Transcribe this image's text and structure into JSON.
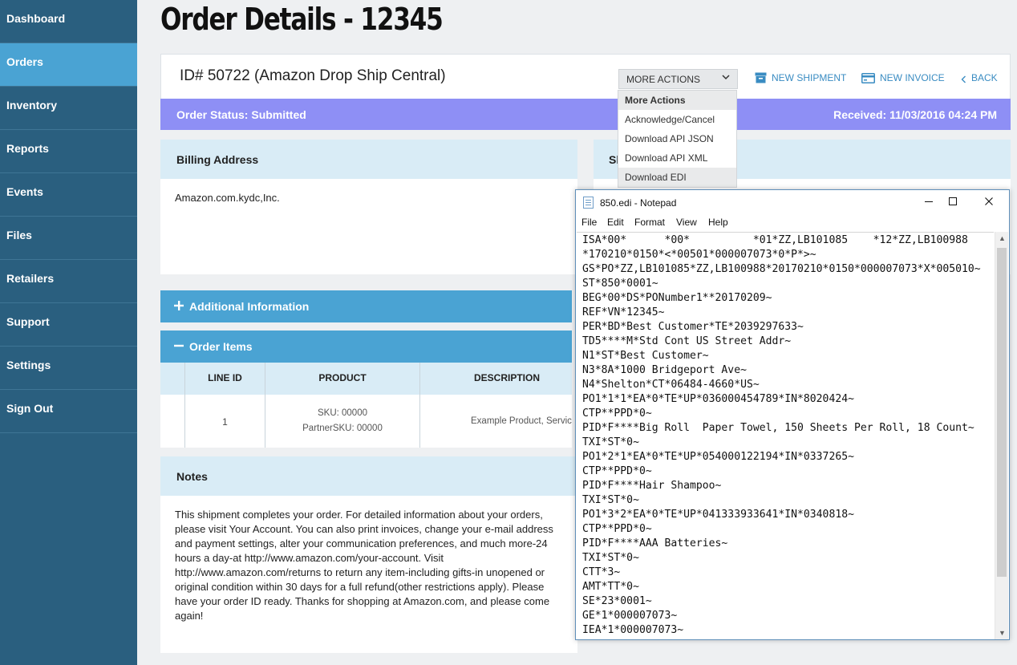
{
  "sidebar": {
    "items": [
      {
        "label": "Dashboard"
      },
      {
        "label": "Orders"
      },
      {
        "label": "Inventory"
      },
      {
        "label": "Reports"
      },
      {
        "label": "Events"
      },
      {
        "label": "Files"
      },
      {
        "label": "Retailers"
      },
      {
        "label": "Support"
      },
      {
        "label": "Settings"
      },
      {
        "label": "Sign Out"
      }
    ],
    "active": "Orders"
  },
  "page": {
    "title": "Order Details - 12345"
  },
  "order": {
    "id_label": "ID# 50722 (Amazon Drop Ship Central)",
    "more_actions_label": "MORE ACTIONS",
    "new_shipment_label": "NEW SHIPMENT",
    "new_invoice_label": "NEW INVOICE",
    "back_label": "BACK",
    "status_text": "Order Status: Submitted",
    "received_text": "Received: 11/03/2016 04:24 PM"
  },
  "dropdown": {
    "options": [
      "More Actions",
      "Acknowledge/Cancel",
      "Download API JSON",
      "Download API XML",
      "Download EDI"
    ]
  },
  "billing": {
    "heading": "Billing Address",
    "name": "Amazon.com.kydc,Inc.",
    "shipping_heading_partial": "Sl"
  },
  "sections": {
    "additional_info": "Additional Information",
    "order_items": "Order Items",
    "notes": "Notes"
  },
  "items_table": {
    "columns": [
      "LINE ID",
      "PRODUCT",
      "DESCRIPTION"
    ],
    "rows": [
      {
        "line_id": "1",
        "sku": "SKU: 00000",
        "partner_sku": "PartnerSKU: 00000",
        "description": "Example Product, Servic"
      }
    ]
  },
  "notes": {
    "text": "This shipment completes your order. For detailed information about your orders, please visit Your Account. You can also print invoices, change your e-mail address and payment settings, alter your communication preferences, and much more-24 hours a day-at http://www.amazon.com/your-account. Visit http://www.amazon.com/returns to return any item-including gifts-in unopened or original condition within 30 days for a full refund(other restrictions apply). Please have your order ID ready. Thanks for shopping at Amazon.com, and please come again!"
  },
  "notepad": {
    "title": "850.edi - Notepad",
    "menu": [
      "File",
      "Edit",
      "Format",
      "View",
      "Help"
    ],
    "lines": [
      "ISA*00*      *00*          *01*ZZ,LB101085    *12*ZZ,LB100988",
      "*170210*0150*<*00501*000007073*0*P*>~",
      "GS*PO*ZZ,LB101085*ZZ,LB100988*20170210*0150*000007073*X*005010~",
      "ST*850*0001~",
      "BEG*00*DS*PONumber1**20170209~",
      "REF*VN*12345~",
      "PER*BD*Best Customer*TE*2039297633~",
      "TD5****M*Std Cont US Street Addr~",
      "N1*ST*Best Customer~",
      "N3*8A*1000 Bridgeport Ave~",
      "N4*Shelton*CT*06484-4660*US~",
      "PO1*1*1*EA*0*TE*UP*036000454789*IN*8020424~",
      "CTP**PPD*0~",
      "PID*F****Big Roll  Paper Towel, 150 Sheets Per Roll, 18 Count~",
      "TXI*ST*0~",
      "PO1*2*1*EA*0*TE*UP*054000122194*IN*0337265~",
      "CTP**PPD*0~",
      "PID*F****Hair Shampoo~",
      "TXI*ST*0~",
      "PO1*3*2*EA*0*TE*UP*041333933641*IN*0340818~",
      "CTP**PPD*0~",
      "PID*F****AAA Batteries~",
      "TXI*ST*0~",
      "CTT*3~",
      "AMT*TT*0~",
      "SE*23*0001~",
      "GE*1*000007073~",
      "IEA*1*000007073~"
    ]
  }
}
